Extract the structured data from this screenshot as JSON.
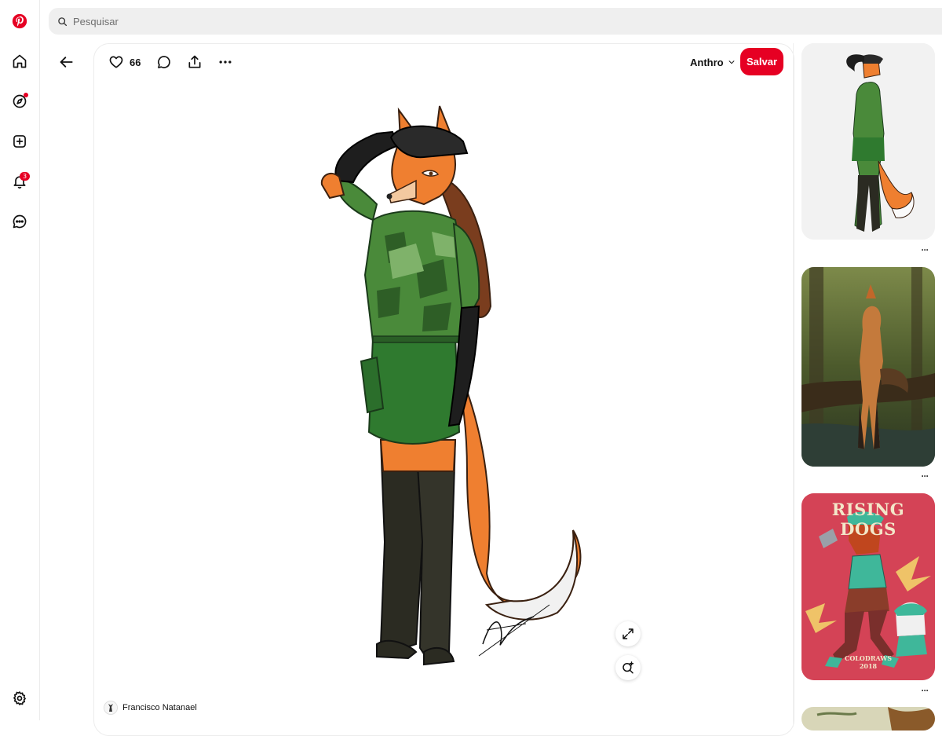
{
  "search": {
    "placeholder": "Pesquisar"
  },
  "pin": {
    "like_count": "66",
    "board_name": "Anthro",
    "save_label": "Salvar",
    "author_name": "Francisco Natanael"
  },
  "related": [
    {
      "title_text": ""
    },
    {
      "title_text": ""
    },
    {
      "poster_title": "RISING DOGS",
      "poster_credit_line1": "COLODRAWS",
      "poster_credit_line2": "2018"
    }
  ],
  "notifications": {
    "badge_count": "3"
  },
  "colors": {
    "brand": "#e60023",
    "search_bg": "#efefef",
    "camo_green": "#4a8a3a",
    "skirt_green": "#2f7a2f",
    "fox_orange": "#e8782e"
  },
  "icons": [
    "pinterest-logo-icon",
    "home-icon",
    "explore-icon",
    "create-icon",
    "bell-icon",
    "messages-icon",
    "settings-icon",
    "search-icon",
    "back-arrow-icon",
    "heart-icon",
    "comment-icon",
    "share-icon",
    "more-icon",
    "chevron-down-icon",
    "expand-icon",
    "visual-search-icon"
  ]
}
